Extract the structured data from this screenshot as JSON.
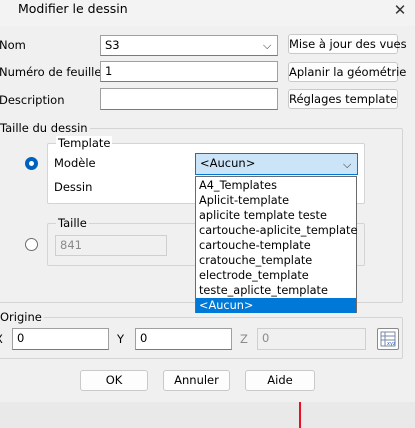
{
  "window": {
    "title": "Modifier le dessin",
    "close": "✕"
  },
  "form": {
    "nom_label": "Nom",
    "nom_value": "S3",
    "numero_label": "Numéro de feuille",
    "numero_value": "1",
    "description_label": "Description",
    "description_value": ""
  },
  "buttons": {
    "update_views": "Mise à jour des vues",
    "flatten": "Aplanir la géométrie",
    "template_settings": "Réglages template",
    "ok": "OK",
    "cancel": "Annuler",
    "help": "Aide"
  },
  "drawing_size": {
    "group_label": "Taille du dessin",
    "template_group_label": "Template",
    "modele_label": "Modèle",
    "modele_value": "<Aucun>",
    "dessin_label": "Dessin",
    "taille_group_label": "Taille",
    "taille_value": "841"
  },
  "dropdown": {
    "items": [
      "A4_Templates",
      "Aplicit-template",
      "aplicite template teste",
      "cartouche-aplicite_template",
      "cartouche-template",
      "cratouche_template",
      "electrode_template",
      "teste_aplicte_template",
      "<Aucun>"
    ],
    "selected": "<Aucun>"
  },
  "origin": {
    "group_label": "Origine",
    "x_label": "X",
    "x_value": "0",
    "y_label": "Y",
    "y_value": "0",
    "z_label": "Z",
    "z_value": "0"
  },
  "icons": {
    "window_close": "close-icon",
    "dropdown": "chevron-down-icon",
    "coordinate_picker": "xyz-axis-icon"
  }
}
